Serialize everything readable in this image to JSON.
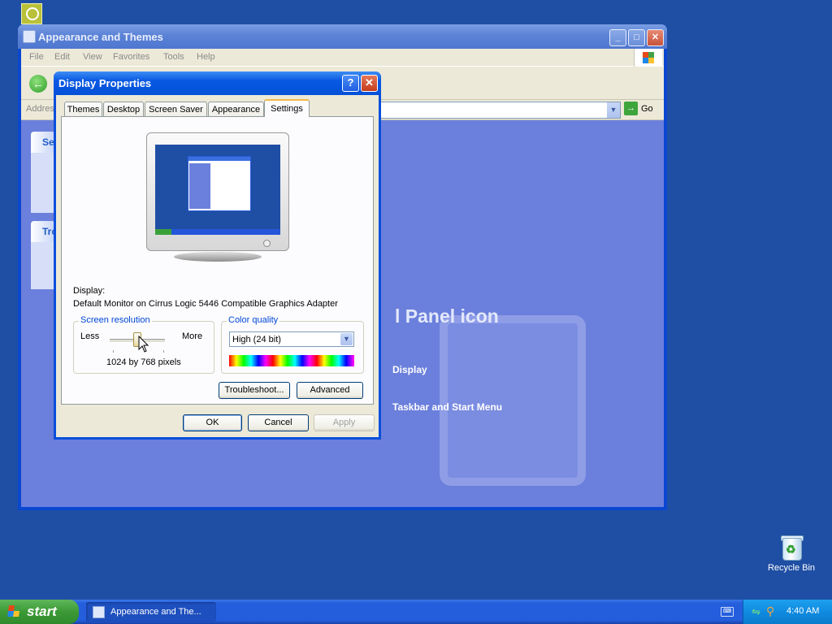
{
  "desktop": {
    "recycle_bin_label": "Recycle Bin"
  },
  "explorer": {
    "title": "Appearance and Themes",
    "menu": [
      "File",
      "Edit",
      "View",
      "Favorites",
      "Tools",
      "Help"
    ],
    "address_label": "Address",
    "go_label": "Go",
    "panel_heading_1": "See",
    "panel_heading_2": "Tro",
    "pick_title": "l Panel icon",
    "links": {
      "display": "Display",
      "taskbar": "Taskbar and Start Menu"
    }
  },
  "dialog": {
    "title": "Display Properties",
    "tabs": [
      "Themes",
      "Desktop",
      "Screen Saver",
      "Appearance",
      "Settings"
    ],
    "active_tab": "Settings",
    "display_label": "Display:",
    "display_value": "Default Monitor on Cirrus Logic 5446 Compatible Graphics Adapter",
    "screen_resolution": {
      "label": "Screen resolution",
      "less": "Less",
      "more": "More",
      "value_text": "1024 by 768 pixels",
      "slider_level": 0.5
    },
    "color_quality": {
      "label": "Color quality",
      "selected": "High (24 bit)"
    },
    "buttons": {
      "troubleshoot": "Troubleshoot...",
      "advanced": "Advanced",
      "ok": "OK",
      "cancel": "Cancel",
      "apply": "Apply"
    }
  },
  "taskbar": {
    "start_label": "start",
    "task_label": "Appearance and The...",
    "clock": "4:40 AM"
  }
}
